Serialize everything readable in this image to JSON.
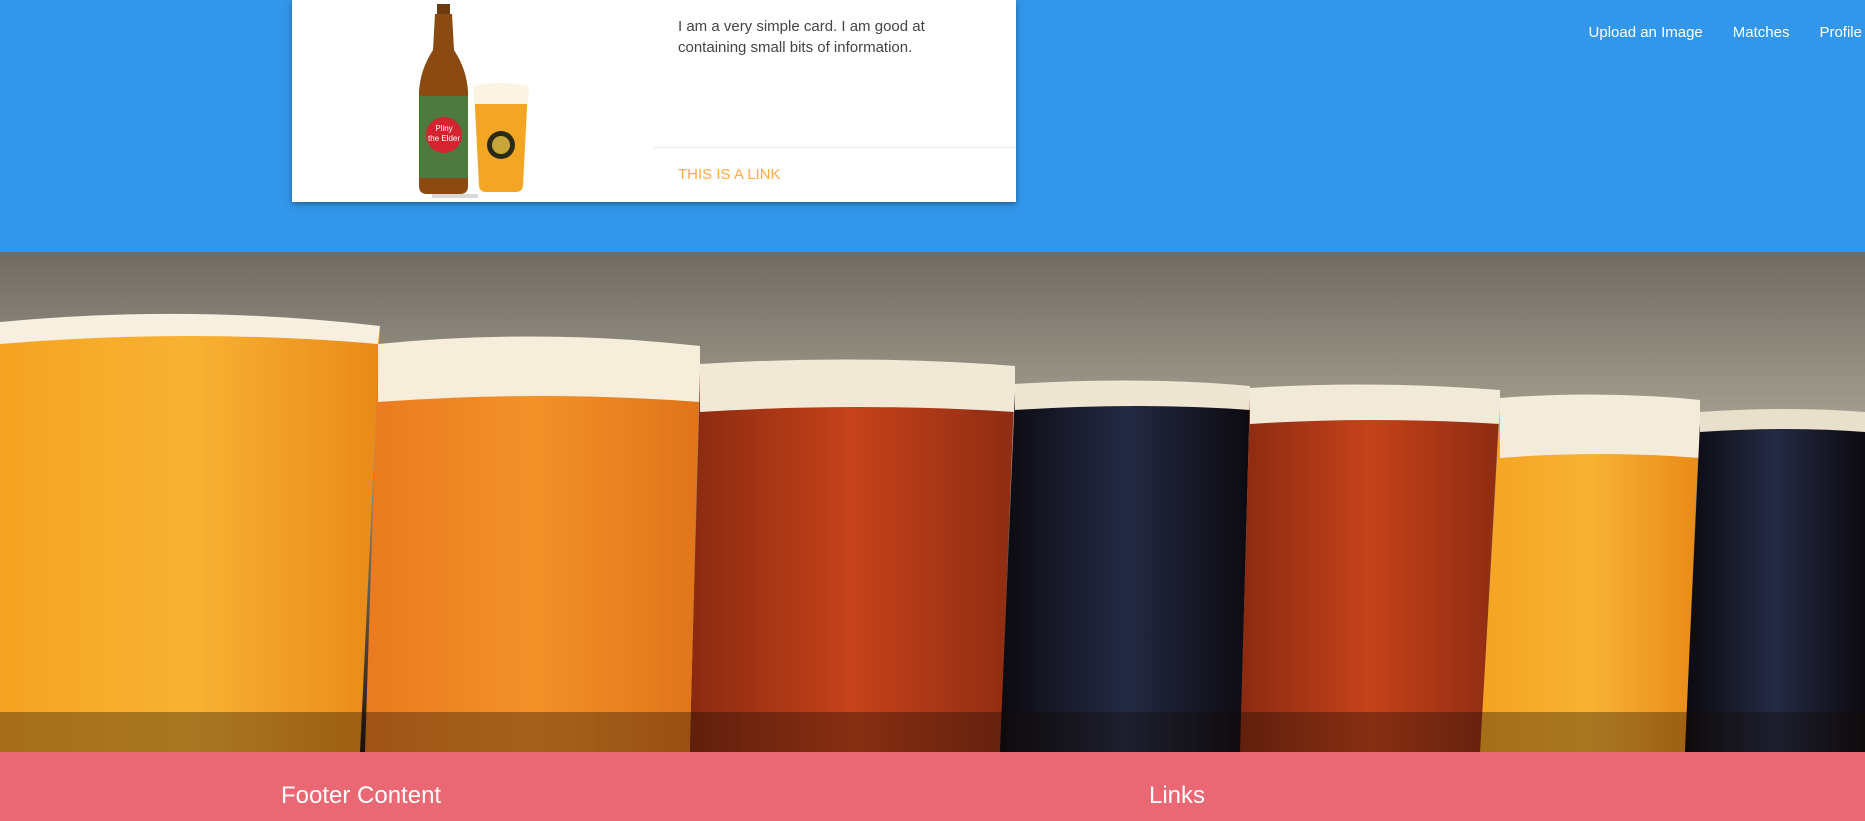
{
  "nav": {
    "upload": "Upload an Image",
    "matches": "Matches",
    "profile": "Profile"
  },
  "card": {
    "image_label": "Pliny the Elder bottle and glass",
    "bottle_label_line1": "Pliny",
    "bottle_label_line2": "the Elder",
    "text": "I am a very simple card. I am good at containing small bits of information.",
    "link": "THIS IS A LINK"
  },
  "hero": {
    "alt": "Row of craft beer glasses"
  },
  "footer": {
    "left_title": "Footer Content",
    "right_title": "Links"
  },
  "colors": {
    "primary_blue": "#3296ea",
    "footer_red": "#e96874",
    "link_orange": "#ffab40"
  }
}
